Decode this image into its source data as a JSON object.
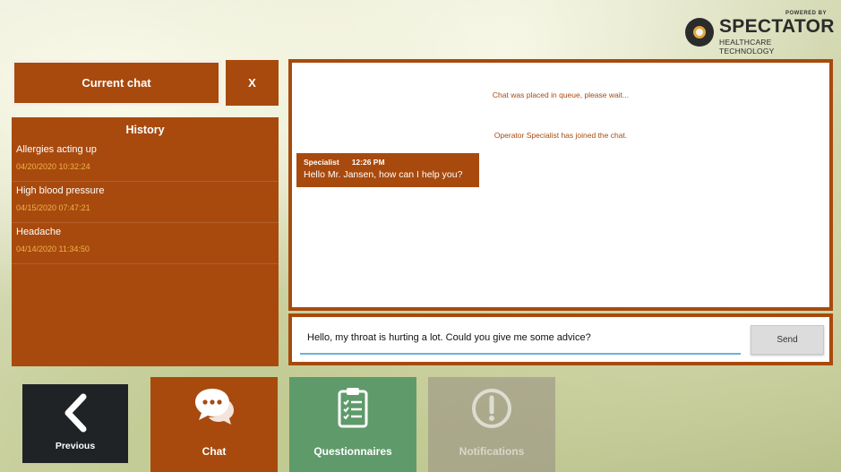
{
  "logo": {
    "powered_by": "POWERED BY",
    "brand": "SPECTATOR",
    "tagline": "HEALTHCARE TECHNOLOGY"
  },
  "left_panel": {
    "current_chat_label": "Current chat",
    "close_label": "X",
    "history": {
      "title": "History",
      "items": [
        {
          "name": "Allergies acting up",
          "date": "04/20/2020 10:32:24"
        },
        {
          "name": "High blood pressure",
          "date": "04/15/2020 07:47:21"
        },
        {
          "name": "Headache",
          "date": "04/14/2020 11:34:50"
        }
      ]
    }
  },
  "chat": {
    "system_messages": [
      "Chat was placed in queue, please wait...",
      "Operator Specialist has joined the chat."
    ],
    "messages": [
      {
        "sender": "Specialist",
        "time": "12:26 PM",
        "text": "Hello Mr. Jansen, how can I help you?"
      }
    ],
    "input_value": "Hello, my throat is hurting a lot. Could you give me some advice?",
    "send_label": "Send"
  },
  "nav": {
    "previous_label": "Previous",
    "chat_label": "Chat",
    "questionnaires_label": "Questionnaires",
    "notifications_label": "Notifications"
  },
  "icons": {
    "previous": "chevron-left-icon",
    "chat": "chat-bubbles-icon",
    "questionnaires": "clipboard-checklist-icon",
    "notifications": "exclamation-circle-icon"
  },
  "colors": {
    "primary": "#a84a0e",
    "accent_date": "#f0b34a",
    "questionnaires": "#5f9a6a",
    "previous": "#1f2326",
    "input_underline": "#6fb0d8"
  }
}
